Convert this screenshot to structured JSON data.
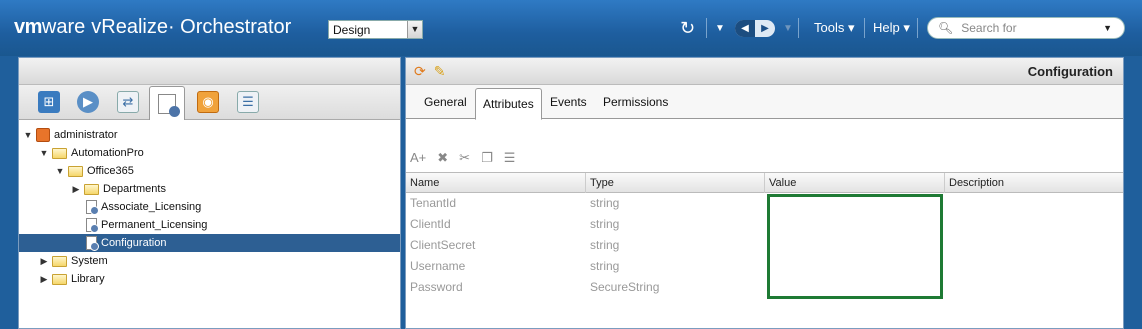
{
  "header": {
    "brand_vm": "vm",
    "brand_ware": "ware",
    "product": "vRealize· Orchestrator",
    "mode_selected": "Design",
    "menu_tools": "Tools ▾",
    "menu_help": "Help ▾",
    "search_placeholder": "Search for"
  },
  "left_panel": {
    "toolbar_icons": [
      "inventory-icon",
      "run-icon",
      "workflow-icon",
      "design-icon",
      "package-icon",
      "actions-icon"
    ],
    "tree": [
      {
        "label": "administrator",
        "level": 0,
        "type": "user",
        "expanded": true
      },
      {
        "label": "AutomationPro",
        "level": 1,
        "type": "folder",
        "expanded": true
      },
      {
        "label": "Office365",
        "level": 2,
        "type": "folder",
        "expanded": true
      },
      {
        "label": "Departments",
        "level": 3,
        "type": "folder",
        "expanded": false
      },
      {
        "label": "Associate_Licensing",
        "level": 3,
        "type": "workflow"
      },
      {
        "label": "Permanent_Licensing",
        "level": 3,
        "type": "workflow"
      },
      {
        "label": "Configuration",
        "level": 3,
        "type": "workflow",
        "selected": true
      },
      {
        "label": "System",
        "level": 1,
        "type": "folder",
        "expanded": false
      },
      {
        "label": "Library",
        "level": 1,
        "type": "folder",
        "expanded": false
      }
    ]
  },
  "right_panel": {
    "title": "Configuration",
    "tabs": [
      "General",
      "Attributes",
      "Events",
      "Permissions"
    ],
    "active_tab": "Attributes",
    "toolbar_glyphs": [
      "A+",
      "✖",
      "✂",
      "❐",
      "☰"
    ],
    "columns": [
      "Name",
      "Type",
      "Value",
      "Description"
    ],
    "rows": [
      {
        "name": "TenantId",
        "type": "string",
        "value": "",
        "description": ""
      },
      {
        "name": "ClientId",
        "type": "string",
        "value": "",
        "description": ""
      },
      {
        "name": "ClientSecret",
        "type": "string",
        "value": "",
        "description": ""
      },
      {
        "name": "Username",
        "type": "string",
        "value": "",
        "description": ""
      },
      {
        "name": "Password",
        "type": "SecureString",
        "value": "",
        "description": ""
      }
    ]
  },
  "colors": {
    "topbar": "#1e5e9f",
    "selection": "#2d5f93",
    "highlight_border": "#1e7a34"
  }
}
